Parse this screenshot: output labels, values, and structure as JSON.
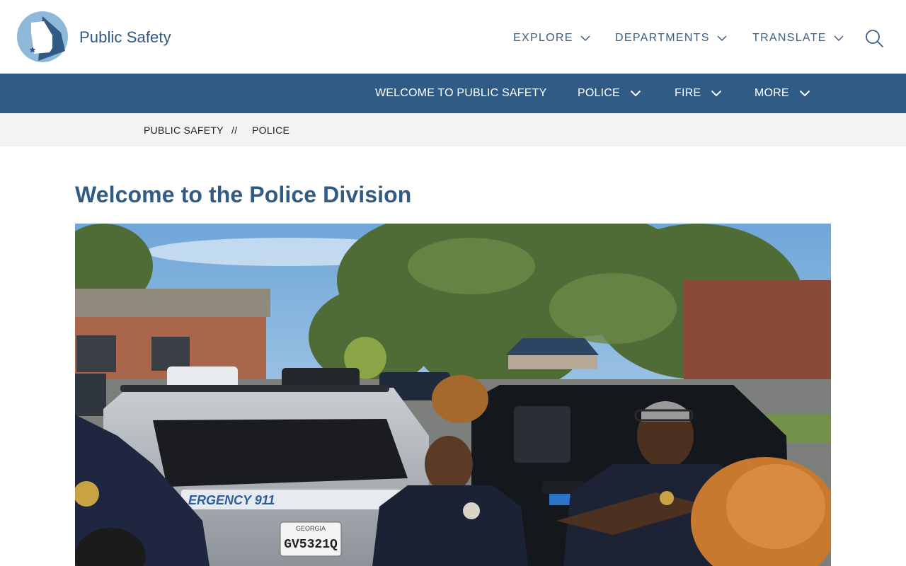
{
  "site": {
    "name": "Public Safety"
  },
  "top_nav": [
    {
      "label": "EXPLORE"
    },
    {
      "label": "DEPARTMENTS"
    },
    {
      "label": "TRANSLATE"
    }
  ],
  "sub_nav": [
    {
      "label": "WELCOME TO PUBLIC SAFETY"
    },
    {
      "label": "POLICE"
    },
    {
      "label": "FIRE"
    },
    {
      "label": "MORE"
    }
  ],
  "breadcrumb": {
    "items": [
      "PUBLIC SAFETY",
      "POLICE"
    ],
    "separator": "//"
  },
  "page": {
    "title": "Welcome to the Police Division"
  },
  "hero": {
    "vehicle_text": "ERGENCY 911",
    "plate_state": "GEORGIA",
    "plate_number": "GV5321Q"
  },
  "colors": {
    "brand_blue": "#2f5b84",
    "breadcrumb_bg": "#f3f3f3"
  },
  "icons": [
    "georgia-state-logo-icon",
    "chevron-down-icon",
    "search-icon"
  ]
}
